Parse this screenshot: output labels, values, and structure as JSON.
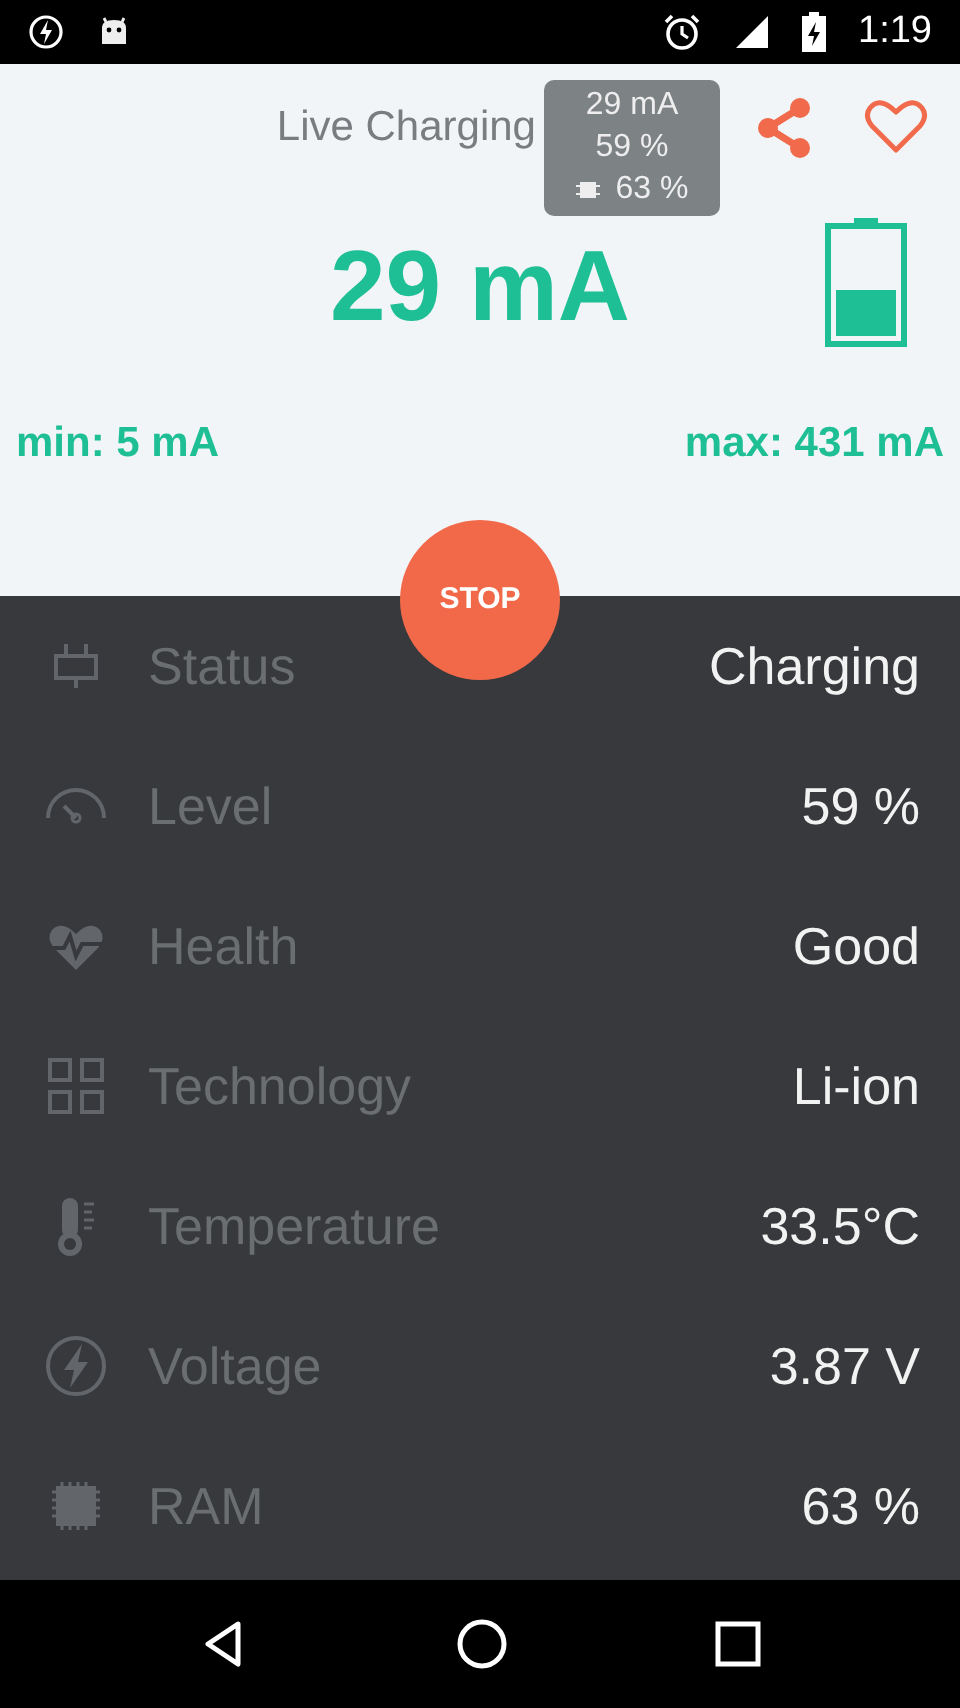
{
  "status_bar": {
    "time": "1:19"
  },
  "header": {
    "title": "Live Charging",
    "current": "29 mA",
    "min": "min: 5 mA",
    "max": "max: 431 mA"
  },
  "popup": {
    "lines": [
      {
        "kind": "text",
        "text": "29 mA"
      },
      {
        "kind": "text",
        "text": "59 %"
      },
      {
        "kind": "ram",
        "text": "63 %"
      }
    ]
  },
  "stop_button": "STOP",
  "rows": [
    {
      "kind": "plug",
      "label": "Status",
      "value": "Charging"
    },
    {
      "kind": "gauge",
      "label": "Level",
      "value": "59 %"
    },
    {
      "kind": "heart",
      "label": "Health",
      "value": "Good"
    },
    {
      "kind": "grid",
      "label": "Technology",
      "value": "Li-ion"
    },
    {
      "kind": "thermo",
      "label": "Temperature",
      "value": "33.5°C"
    },
    {
      "kind": "bolt",
      "label": "Voltage",
      "value": "3.87 V"
    },
    {
      "kind": "chip",
      "label": "RAM",
      "value": "63 %"
    }
  ]
}
